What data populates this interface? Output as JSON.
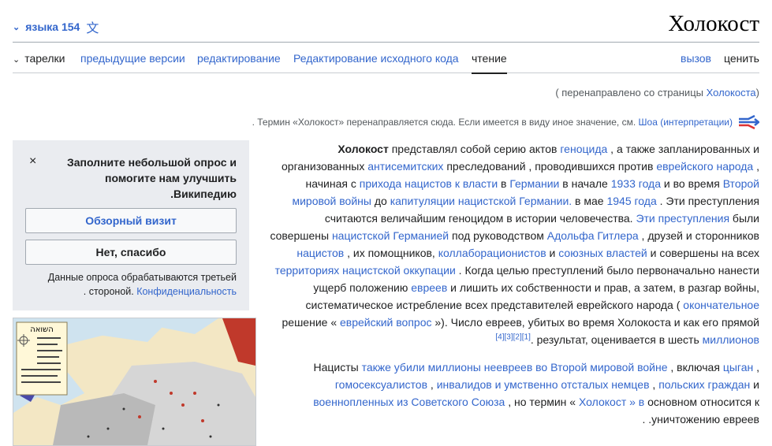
{
  "header": {
    "languages_label": "языка 154",
    "title": "Холокост"
  },
  "tabs": {
    "talk": "тарелки",
    "history": "предыдущие версии",
    "edit": "редактирование",
    "edit_source": "Редактирование исходного кода",
    "read": "чтение",
    "watch": "вызов",
    "tools": "ценить"
  },
  "redirect": {
    "prefix": "( перенаправлено со страницы ",
    "link": "Холокоста",
    "suffix": ")"
  },
  "hatnote": {
    "text": ". Термин «Холокост» перенаправляется сюда. Если имеется в виду иное значение, см. ",
    "link": "Шоа (интерпретации)"
  },
  "survey": {
    "close": "×",
    "question_lines": [
      "Заполните небольшой опрос и",
      "помогите нам улучшить",
      ".Википедию"
    ],
    "tour_button": "Обзорный визит",
    "no_thanks_button": "Нет, спасибо",
    "note_line1": "Данные опроса обрабатываются третьей",
    "note_prefix": ". стороной. ",
    "privacy_link": "Конфиденциальность"
  },
  "map": {
    "title": "השואה"
  },
  "article": {
    "p1": [
      {
        "b": "Холокост"
      },
      {
        "t": " представлял собой серию актов "
      },
      {
        "a": "геноцида"
      },
      {
        "t": " , а также запланированных и"
      },
      {
        "br": 1
      },
      {
        "t": "организованных "
      },
      {
        "a": "антисемитских"
      },
      {
        "t": " преследований , проводившихся против "
      },
      {
        "a": "еврейского народа"
      },
      {
        "t": " ,"
      },
      {
        "br": 1
      },
      {
        "t": "начиная с "
      },
      {
        "a": "прихода нацистов к власти"
      },
      {
        "t": " в "
      },
      {
        "a": "Германии"
      },
      {
        "t": " в начале "
      },
      {
        "a": "1933 года"
      },
      {
        "t": " и во время "
      },
      {
        "a": "Второй"
      },
      {
        "br": 1
      },
      {
        "a": "мировой войны"
      },
      {
        "t": " до "
      },
      {
        "a": "капитуляции нацистской Германии."
      },
      {
        "t": " в мае "
      },
      {
        "a": "1945 года"
      },
      {
        "t": " . Эти преступления"
      },
      {
        "br": 1
      },
      {
        "t": "считаются величайшим геноцидом в истории человечества. "
      },
      {
        "a": "Эти преступления"
      },
      {
        "t": " были"
      },
      {
        "br": 1
      },
      {
        "t": "совершены "
      },
      {
        "a": "нацистской Германией"
      },
      {
        "t": " под руководством "
      },
      {
        "a": "Адольфа Гитлера"
      },
      {
        "t": " , друзей и сторонников"
      },
      {
        "br": 1
      },
      {
        "a": "нацистов"
      },
      {
        "t": " , их помощников, "
      },
      {
        "a": "коллаборационистов"
      },
      {
        "t": " и "
      },
      {
        "a": "союзных властей"
      },
      {
        "t": " и совершены на всех"
      },
      {
        "br": 1
      },
      {
        "a": "территориях нацистской оккупации"
      },
      {
        "t": " . Когда целью преступлений было первоначально нанести"
      },
      {
        "br": 1
      },
      {
        "t": "ущерб положению "
      },
      {
        "a": "евреев"
      },
      {
        "t": " и лишить их собственности и прав, а затем, в разгар войны,"
      },
      {
        "br": 1
      },
      {
        "t": "систематическое истребление всех представителей еврейского народа ( "
      },
      {
        "a": "окончательное"
      },
      {
        "br": 1
      },
      {
        "t": "решение « "
      },
      {
        "a": "еврейский вопрос"
      },
      {
        "t": " »). Число евреев, убитых во время Холокоста и как его прямой"
      },
      {
        "br": 1
      },
      {
        "sup": "[4][3][2][1]"
      },
      {
        "t": ". результат, оценивается в шесть "
      },
      {
        "a": "миллионов"
      }
    ],
    "p2": [
      {
        "t": "Нацисты "
      },
      {
        "a": "также убили миллионы неевреев во Второй мировой войне"
      },
      {
        "t": " , включая "
      },
      {
        "a": "цыган"
      },
      {
        "t": " ,"
      },
      {
        "br": 1
      },
      {
        "a": "гомосексуалистов"
      },
      {
        "t": " , "
      },
      {
        "a": "инвалидов и умственно отсталых немцев"
      },
      {
        "t": " , "
      },
      {
        "a": "польских граждан"
      },
      {
        "t": " и"
      },
      {
        "br": 1
      },
      {
        "a": "военнопленных из Советского Союза"
      },
      {
        "t": " , но термин « "
      },
      {
        "a": "Холокост » в"
      },
      {
        "t": " основном относится к"
      },
      {
        "br": 1
      },
      {
        "t": ". .уничтожению евреев"
      }
    ]
  },
  "colors": {
    "link": "#3366cc",
    "text": "#202122",
    "survey_bg": "#eaecf0"
  }
}
